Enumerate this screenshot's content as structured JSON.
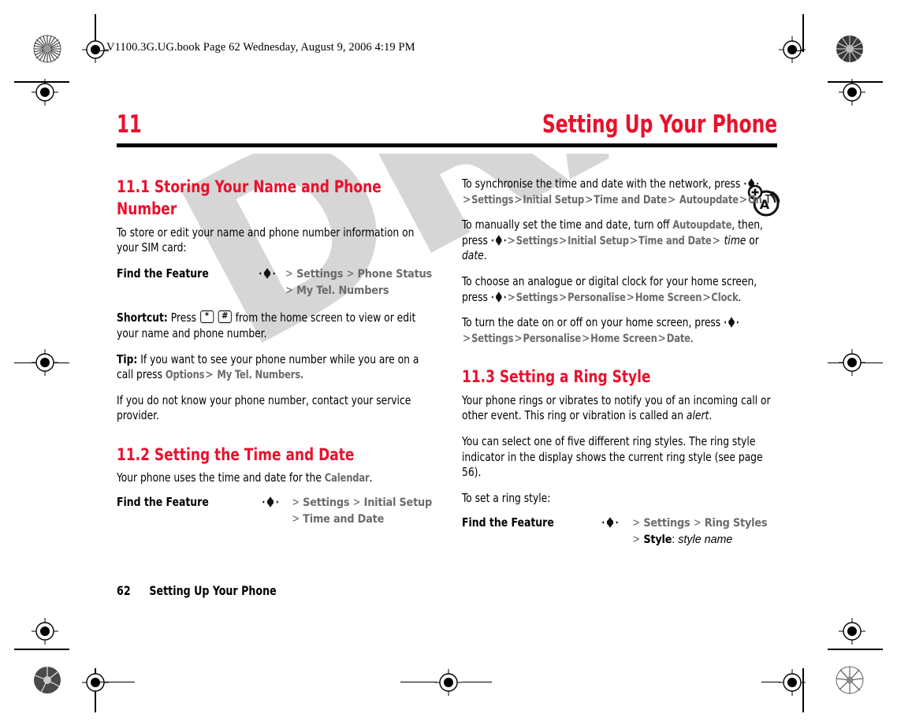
{
  "header_line": "V1100.3G.UG.book  Page 62  Wednesday, August 9, 2006  4:19 PM",
  "watermark": "DRAFT",
  "chapter": {
    "number": "11",
    "title": "Setting Up Your Phone"
  },
  "colors": {
    "accent_red": "#e8112d",
    "menu_gray": "#6b6b6b",
    "watermark_gray": "#d6d6d6",
    "rule_black": "#000000"
  },
  "icons": {
    "nav_key": "navigation-key-icon",
    "star_key": "star-key-icon",
    "pound_key": "pound-key-icon",
    "network": "network-antenna-icon",
    "registration": "registration-target-icon",
    "rosette": "color-rosette-icon"
  },
  "left_column": {
    "section_1": {
      "heading": "11.1 Storing Your Name and Phone Number",
      "intro": "To store or edit your name and phone number information on your SIM card:",
      "find_feature": {
        "label": "Find the Feature",
        "line1": [
          "Settings",
          "Phone Status"
        ],
        "line2": [
          "My Tel. Numbers"
        ]
      },
      "shortcut_lead": "Shortcut:",
      "shortcut_press": "Press",
      "shortcut_keys": [
        "*",
        "#"
      ],
      "shortcut_tail": "from the home screen to view or edit your name and phone number.",
      "tip_lead": "Tip:",
      "tip_text_1": "If you want to see your phone number while you are on a call press",
      "tip_menu_1": "Options",
      "tip_menu_2": "My Tel. Numbers",
      "tip_tail": ".",
      "closing": "If you do not know your phone number, contact your service provider."
    },
    "section_2": {
      "heading": "11.2 Setting the Time and Date",
      "intro_pre": "Your phone uses the time and date for the",
      "intro_menu": "Calendar",
      "intro_post": ".",
      "find_feature": {
        "label": "Find the Feature",
        "line1": [
          "Settings",
          "Initial Setup"
        ],
        "line2": [
          "Time and Date"
        ]
      }
    }
  },
  "right_column": {
    "para_sync": {
      "text_pre": "To synchronise the time and date with the network, press",
      "path": [
        "Settings",
        "Initial Setup",
        "Time and Date",
        "Autoupdate",
        "On"
      ],
      "tail": ".T"
    },
    "para_manual": {
      "text_pre": "To manually set the time and date, turn off",
      "menu_inline": "Autoupdate",
      "text_mid": ", then, press",
      "path": [
        "Settings",
        "Initial Setup",
        "Time and Date"
      ],
      "italic_1": "time",
      "conj": "or",
      "italic_2": "date",
      "tail": "."
    },
    "para_clock": {
      "text_pre": "To choose an analogue or digital clock for your home screen, press",
      "path": [
        "Settings",
        "Personalise",
        "Home Screen",
        "Clock"
      ],
      "tail": "."
    },
    "para_date": {
      "text_pre": "To turn the date on or off on your home screen, press",
      "path": [
        "Settings",
        "Personalise",
        "Home Screen",
        "Date"
      ],
      "tail": "."
    },
    "section_3": {
      "heading": "11.3 Setting a Ring Style",
      "para_1_pre": "Your phone rings or vibrates to notify you of an incoming call or other event. This ring or vibration is called an",
      "para_1_italic": "alert",
      "para_1_post": ".",
      "para_2": "You can select one of five different ring styles. The ring style indicator in the display shows the current ring style (see page 56).",
      "para_3": "To set a ring style:",
      "find_feature": {
        "label": "Find the Feature",
        "line1": [
          "Settings",
          "Ring Styles"
        ],
        "line2_menu": "Style",
        "line2_sep": ":",
        "line2_italic": "style name"
      }
    }
  },
  "footer": {
    "page_number": "62",
    "title": "Setting Up Your Phone"
  }
}
